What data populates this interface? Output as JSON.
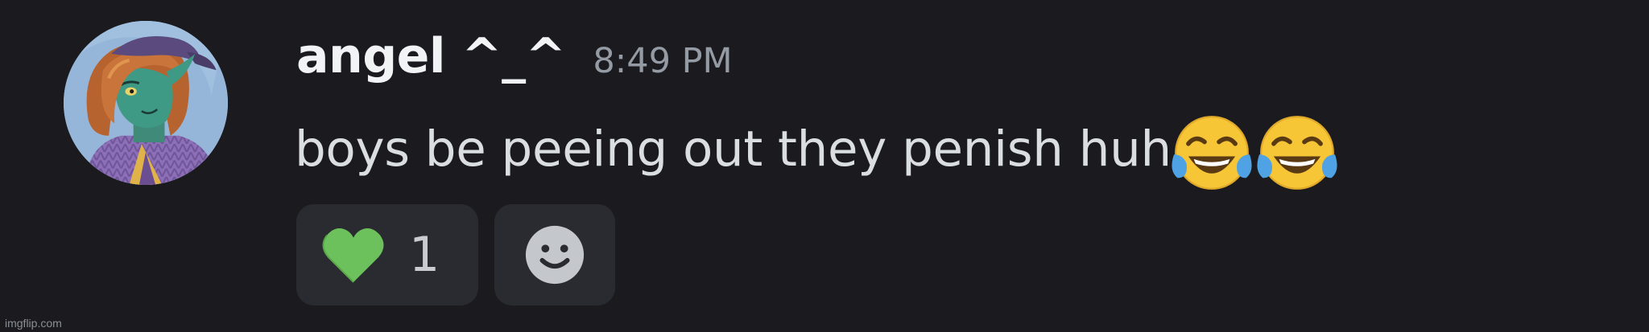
{
  "message": {
    "author": "angel ^_^",
    "timestamp": "8:49 PM",
    "content": "boys be peeing out they penish huh",
    "emojis": [
      "face-with-tears-of-joy",
      "face-with-tears-of-joy"
    ]
  },
  "reactions": [
    {
      "emoji": "green-heart",
      "count": "1"
    }
  ],
  "add_reaction": {
    "icon": "smiley-face-icon"
  },
  "watermark": "imgflip.com",
  "colors": {
    "background": "#1b1b1f",
    "username": "#f2f3f5",
    "timestamp": "#949ba4",
    "content": "#dbdee1",
    "reaction_bg": "#2a2b30",
    "heart": "#6dc15c"
  }
}
